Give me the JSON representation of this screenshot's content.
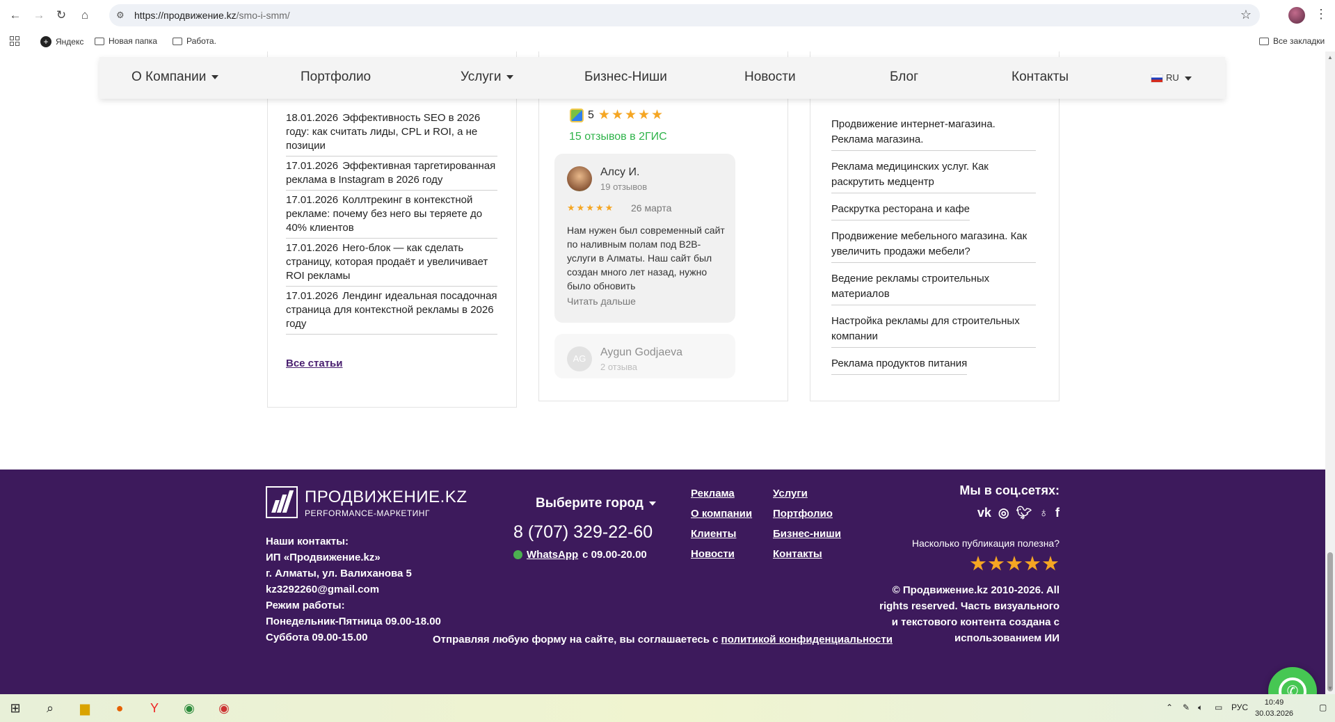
{
  "browser": {
    "url_host": "https://продвижение.kz",
    "url_path": "/smo-i-smm/",
    "bookmarks": [
      "Яндекс",
      "Новая папка",
      "Работа."
    ],
    "all_bookmarks": "Все закладки"
  },
  "sitenav": {
    "items": [
      "О Компании",
      "Портфолио",
      "Услуги",
      "Бизнес-Ниши",
      "Новости",
      "Блог",
      "Контакты"
    ],
    "lang": "RU"
  },
  "news": {
    "items": [
      {
        "date": "18.01.2026",
        "title": "Эффективность SEO в 2026 году: как считать лиды, CPL и ROI, а не позиции"
      },
      {
        "date": "17.01.2026",
        "title": "Эффективная таргетированная реклама в Instagram в 2026 году"
      },
      {
        "date": "17.01.2026",
        "title": "Коллтрекинг в контекстной рекламе: почему без него вы теряете до 40% клиентов"
      },
      {
        "date": "17.01.2026",
        "title": "Hero-блок — как сделать страницу, которая продаёт и увеличивает ROI рекламы"
      },
      {
        "date": "17.01.2026",
        "title": "Лендинг идеальная посадочная страница для контекстной рекламы в 2026 году"
      }
    ],
    "all_label": "Все статьи"
  },
  "reviews": {
    "rating": "5",
    "stars": "★★★★★",
    "count_label": "15 отзывов в 2ГИС",
    "first": {
      "name": "Алсу И.",
      "count": "19 отзывов",
      "stars": "★★★★★",
      "date": "26 марта",
      "text": "Нам нужен был современный сайт по наливным полам под B2B-услуги в Алматы. Наш сайт был создан много лет назад, нужно было обновить",
      "more": "Читать дальше"
    },
    "second": {
      "initials": "AG",
      "name": "Aygun Godjaeva",
      "count": "2 отзыва"
    }
  },
  "niches": [
    "Продвижение интернет-магазина. Реклама магазина.",
    "Реклама медицинских услуг. Как раскрутить медцентр",
    "Раскрутка ресторана и кафе",
    "Продвижение мебельного магазина. Как увеличить продажи мебели?",
    "Ведение рекламы строительных материалов",
    "Настройка рекламы для строительных компании",
    "Реклама продуктов питания"
  ],
  "footer": {
    "logo_title": "ПРОДВИЖЕНИЕ.KZ",
    "logo_sub": "PERFORMANCE-МАРКЕТИНГ",
    "contacts": [
      "Наши контакты:",
      "ИП «Продвижение.kz»",
      "г. Алматы, ул. Валиханова 5",
      "kz3292260@gmail.com",
      "Режим работы:",
      "Понедельник-Пятница 09.00-18.00",
      "Суббота 09.00-15.00"
    ],
    "city_label": "Выберите город",
    "phone": "8 (707) 329-22-60",
    "whatsapp": "WhatsApp",
    "whatsapp_hours": "с 09.00-20.00",
    "links_col1": [
      "Реклама",
      "О компании",
      "Клиенты",
      "Новости"
    ],
    "links_col2": [
      "Услуги",
      "Портфолио",
      "Бизнес-ниши",
      "Контакты"
    ],
    "social_title": "Мы в соц.сетях:",
    "socials": [
      "vk",
      "instagram",
      "twitter",
      "ok",
      "facebook"
    ],
    "useful_q": "Насколько публикация полезна?",
    "useful_stars": "★★★★★",
    "copyright": "© Продвижение.kz 2010-2026. All rights reserved. Часть визуального и текстового контента создана с использованием ИИ",
    "consent_prefix": "Отправляя любую форму на сайте, вы соглашаетесь с",
    "consent_link": "политикой конфиденциальности"
  },
  "taskbar": {
    "lang": "РУС",
    "time": "10:49",
    "date": "30.03.2026"
  },
  "colors": {
    "footer_bg": "#3d1a5c",
    "star": "#f5a623",
    "green": "#2fb34a",
    "whatsapp": "#46c753"
  }
}
